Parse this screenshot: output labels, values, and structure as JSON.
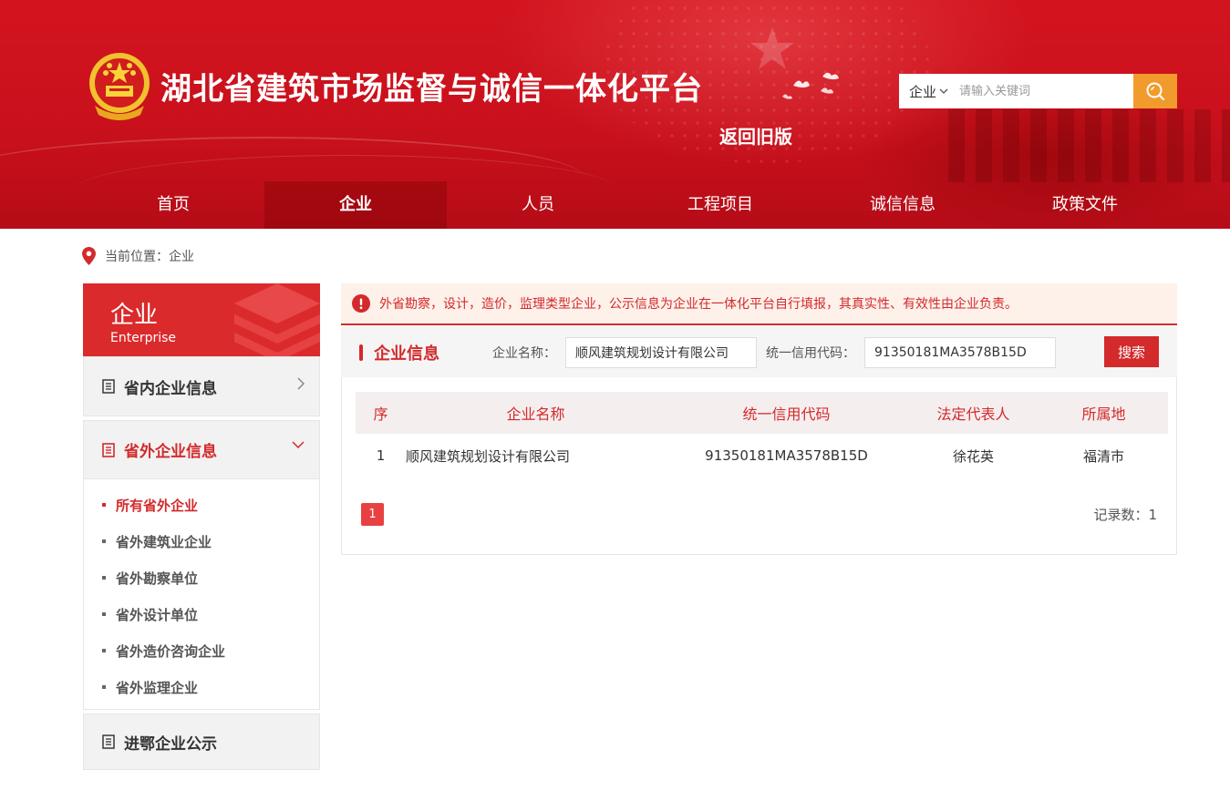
{
  "header": {
    "site_title": "湖北省建筑市场监督与诚信一体化平台",
    "old_version_link": "返回旧版",
    "search": {
      "type_selected": "企业",
      "placeholder": "请输入关键词",
      "button_icon": "search-icon"
    },
    "accent_color": "#d3141f"
  },
  "nav": {
    "items": [
      {
        "label": "首页"
      },
      {
        "label": "企业"
      },
      {
        "label": "人员"
      },
      {
        "label": "工程项目"
      },
      {
        "label": "诚信信息"
      },
      {
        "label": "政策文件"
      }
    ],
    "active": "企业"
  },
  "breadcrumb": {
    "prefix": "当前位置：",
    "current": "企业"
  },
  "sidebar": {
    "title_zh": "企业",
    "title_en": "Enterprise",
    "groups": [
      {
        "label": "省内企业信息",
        "expanded": false
      },
      {
        "label": "省外企业信息",
        "expanded": true
      },
      {
        "label": "进鄂企业公示",
        "expanded": false
      }
    ],
    "sub_items": [
      {
        "label": "所有省外企业"
      },
      {
        "label": "省外建筑业企业"
      },
      {
        "label": "省外勘察单位"
      },
      {
        "label": "省外设计单位"
      },
      {
        "label": "省外造价咨询企业"
      },
      {
        "label": "省外监理企业"
      }
    ],
    "active_sub": "所有省外企业"
  },
  "main": {
    "notice": "外省勘察，设计，造价，监理类型企业，公示信息为企业在一体化平台自行填报，其真实性、有效性由企业负责。",
    "section_title": "企业信息",
    "filter": {
      "name_label": "企业名称：",
      "name_value": "顺风建筑规划设计有限公司",
      "code_label": "统一信用代码：",
      "code_value": "91350181MA3578B15D",
      "search_button": "搜索"
    },
    "table": {
      "columns": [
        "序",
        "企业名称",
        "统一信用代码",
        "法定代表人",
        "所属地"
      ],
      "rows": [
        [
          "1",
          "顺风建筑规划设计有限公司",
          "91350181MA3578B15D",
          "徐花英",
          "福清市"
        ]
      ]
    },
    "pagination": {
      "current_page": "1",
      "record_count": "记录数：1"
    }
  }
}
